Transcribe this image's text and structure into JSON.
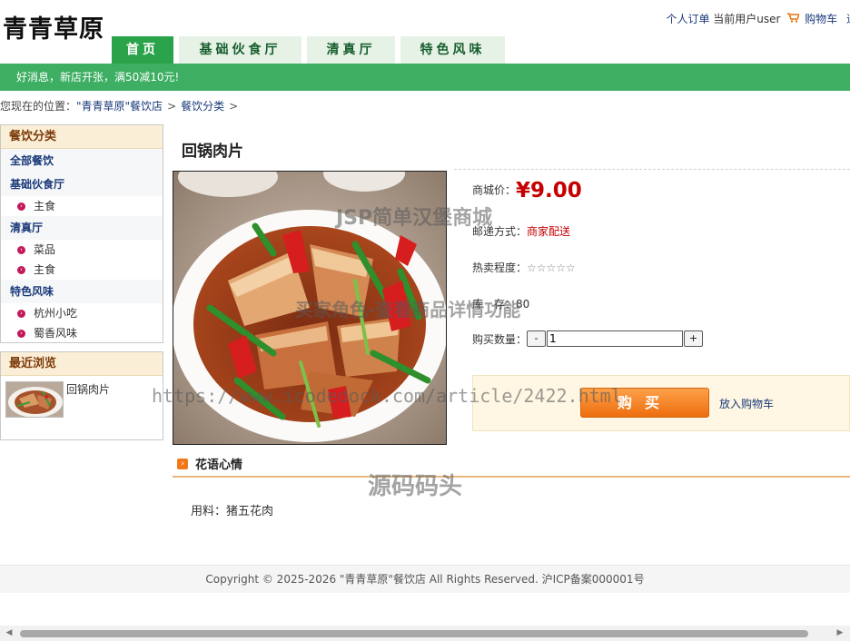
{
  "site": {
    "logo": "青青草原"
  },
  "topbar": {
    "orders": "个人订单",
    "current_user": "当前用户user",
    "cart": "购物车",
    "logout": "退"
  },
  "nav": {
    "tabs": [
      "首页",
      "基础伙食厅",
      "清真厅",
      "特色风味"
    ],
    "active_index": 0
  },
  "notice": "好消息，新店开张，满50减10元!",
  "breadcrumb": {
    "prefix": "您现在的位置：",
    "items": [
      "\"青青草原\"餐饮店",
      "餐饮分类"
    ],
    "separator": ">"
  },
  "sidebar": {
    "category_title": "餐饮分类",
    "groups": [
      {
        "label": "全部餐饮",
        "subs": []
      },
      {
        "label": "基础伙食厅",
        "subs": [
          "主食"
        ]
      },
      {
        "label": "清真厅",
        "subs": [
          "菜品",
          "主食"
        ]
      },
      {
        "label": "特色风味",
        "subs": [
          "杭州小吃",
          "蜀香风味"
        ]
      }
    ],
    "recent_title": "最近浏览",
    "recent_items": [
      {
        "name": "回锅肉片"
      }
    ]
  },
  "product": {
    "title": "回锅肉片",
    "price_label": "商城价：",
    "price": "¥9.00",
    "shipping_label": "邮递方式：",
    "shipping_value": "商家配送",
    "popularity_label": "热卖程度：",
    "popularity_stars": "☆☆☆☆☆",
    "stock_label": "库　存：",
    "stock_value": "80",
    "qty_label": "购买数量：",
    "qty_value": "1",
    "qty_minus": "-",
    "qty_plus": "+",
    "buy_button": "购买",
    "add_to_cart": "放入购物车"
  },
  "detail": {
    "section_title": "花语心情",
    "ingredients": "用料：猪五花肉"
  },
  "footer": {
    "copyright": "Copyright © 2025-2026 \"青青草原\"餐饮店 All Rights Reserved. 沪ICP备案000001号"
  },
  "watermarks": [
    "JSP简单汉堡商城",
    "买家角色-查看商品详情功能",
    "https://www.icodedock.com/article/2422.html",
    "源码码头"
  ],
  "colors": {
    "brand_green": "#3dae62",
    "price_red": "#c40000",
    "buy_orange": "#ee6e0d",
    "sidebar_title_bg": "#fbeed6"
  },
  "icons": {
    "cart": "cart-icon",
    "bullet": "pink-dot-icon",
    "section": "orange-arrow-icon"
  }
}
